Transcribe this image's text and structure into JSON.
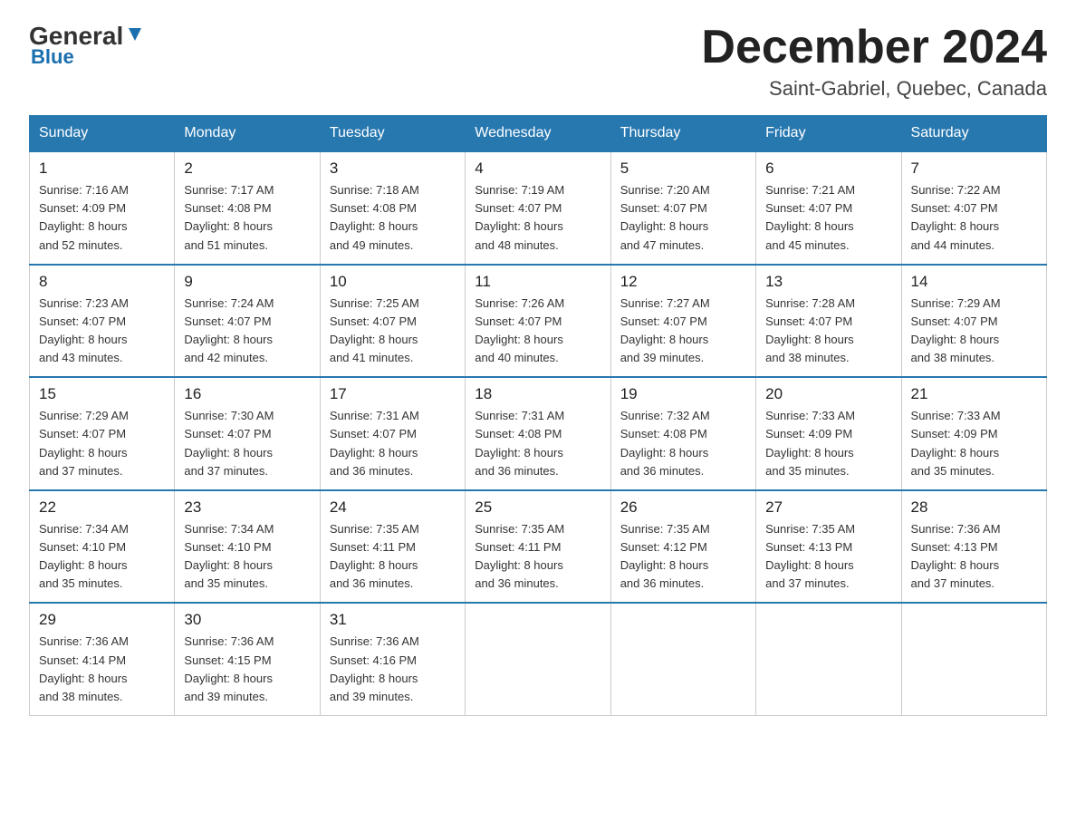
{
  "header": {
    "logo_general": "General",
    "logo_blue": "Blue",
    "month": "December 2024",
    "location": "Saint-Gabriel, Quebec, Canada"
  },
  "weekdays": [
    "Sunday",
    "Monday",
    "Tuesday",
    "Wednesday",
    "Thursday",
    "Friday",
    "Saturday"
  ],
  "weeks": [
    [
      {
        "day": "1",
        "sunrise": "7:16 AM",
        "sunset": "4:09 PM",
        "daylight": "8 hours and 52 minutes."
      },
      {
        "day": "2",
        "sunrise": "7:17 AM",
        "sunset": "4:08 PM",
        "daylight": "8 hours and 51 minutes."
      },
      {
        "day": "3",
        "sunrise": "7:18 AM",
        "sunset": "4:08 PM",
        "daylight": "8 hours and 49 minutes."
      },
      {
        "day": "4",
        "sunrise": "7:19 AM",
        "sunset": "4:07 PM",
        "daylight": "8 hours and 48 minutes."
      },
      {
        "day": "5",
        "sunrise": "7:20 AM",
        "sunset": "4:07 PM",
        "daylight": "8 hours and 47 minutes."
      },
      {
        "day": "6",
        "sunrise": "7:21 AM",
        "sunset": "4:07 PM",
        "daylight": "8 hours and 45 minutes."
      },
      {
        "day": "7",
        "sunrise": "7:22 AM",
        "sunset": "4:07 PM",
        "daylight": "8 hours and 44 minutes."
      }
    ],
    [
      {
        "day": "8",
        "sunrise": "7:23 AM",
        "sunset": "4:07 PM",
        "daylight": "8 hours and 43 minutes."
      },
      {
        "day": "9",
        "sunrise": "7:24 AM",
        "sunset": "4:07 PM",
        "daylight": "8 hours and 42 minutes."
      },
      {
        "day": "10",
        "sunrise": "7:25 AM",
        "sunset": "4:07 PM",
        "daylight": "8 hours and 41 minutes."
      },
      {
        "day": "11",
        "sunrise": "7:26 AM",
        "sunset": "4:07 PM",
        "daylight": "8 hours and 40 minutes."
      },
      {
        "day": "12",
        "sunrise": "7:27 AM",
        "sunset": "4:07 PM",
        "daylight": "8 hours and 39 minutes."
      },
      {
        "day": "13",
        "sunrise": "7:28 AM",
        "sunset": "4:07 PM",
        "daylight": "8 hours and 38 minutes."
      },
      {
        "day": "14",
        "sunrise": "7:29 AM",
        "sunset": "4:07 PM",
        "daylight": "8 hours and 38 minutes."
      }
    ],
    [
      {
        "day": "15",
        "sunrise": "7:29 AM",
        "sunset": "4:07 PM",
        "daylight": "8 hours and 37 minutes."
      },
      {
        "day": "16",
        "sunrise": "7:30 AM",
        "sunset": "4:07 PM",
        "daylight": "8 hours and 37 minutes."
      },
      {
        "day": "17",
        "sunrise": "7:31 AM",
        "sunset": "4:07 PM",
        "daylight": "8 hours and 36 minutes."
      },
      {
        "day": "18",
        "sunrise": "7:31 AM",
        "sunset": "4:08 PM",
        "daylight": "8 hours and 36 minutes."
      },
      {
        "day": "19",
        "sunrise": "7:32 AM",
        "sunset": "4:08 PM",
        "daylight": "8 hours and 36 minutes."
      },
      {
        "day": "20",
        "sunrise": "7:33 AM",
        "sunset": "4:09 PM",
        "daylight": "8 hours and 35 minutes."
      },
      {
        "day": "21",
        "sunrise": "7:33 AM",
        "sunset": "4:09 PM",
        "daylight": "8 hours and 35 minutes."
      }
    ],
    [
      {
        "day": "22",
        "sunrise": "7:34 AM",
        "sunset": "4:10 PM",
        "daylight": "8 hours and 35 minutes."
      },
      {
        "day": "23",
        "sunrise": "7:34 AM",
        "sunset": "4:10 PM",
        "daylight": "8 hours and 35 minutes."
      },
      {
        "day": "24",
        "sunrise": "7:35 AM",
        "sunset": "4:11 PM",
        "daylight": "8 hours and 36 minutes."
      },
      {
        "day": "25",
        "sunrise": "7:35 AM",
        "sunset": "4:11 PM",
        "daylight": "8 hours and 36 minutes."
      },
      {
        "day": "26",
        "sunrise": "7:35 AM",
        "sunset": "4:12 PM",
        "daylight": "8 hours and 36 minutes."
      },
      {
        "day": "27",
        "sunrise": "7:35 AM",
        "sunset": "4:13 PM",
        "daylight": "8 hours and 37 minutes."
      },
      {
        "day": "28",
        "sunrise": "7:36 AM",
        "sunset": "4:13 PM",
        "daylight": "8 hours and 37 minutes."
      }
    ],
    [
      {
        "day": "29",
        "sunrise": "7:36 AM",
        "sunset": "4:14 PM",
        "daylight": "8 hours and 38 minutes."
      },
      {
        "day": "30",
        "sunrise": "7:36 AM",
        "sunset": "4:15 PM",
        "daylight": "8 hours and 39 minutes."
      },
      {
        "day": "31",
        "sunrise": "7:36 AM",
        "sunset": "4:16 PM",
        "daylight": "8 hours and 39 minutes."
      },
      null,
      null,
      null,
      null
    ]
  ],
  "labels": {
    "sunrise": "Sunrise:",
    "sunset": "Sunset:",
    "daylight": "Daylight:"
  }
}
